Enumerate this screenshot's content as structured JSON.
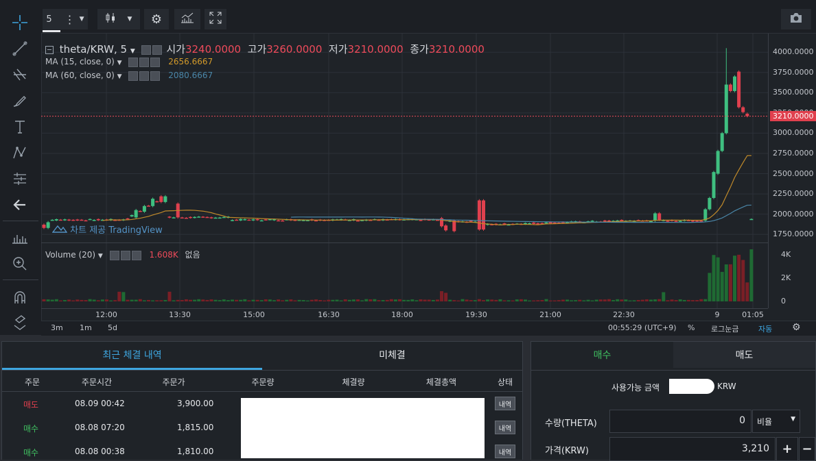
{
  "toolbar": {
    "interval": "5",
    "more_icon": "vertical-dots-icon",
    "chart_style_icon": "candlestick-icon",
    "settings_icon": "gear-icon",
    "indicators_icon": "indicators-icon",
    "fullscreen_icon": "fullscreen-icon",
    "screenshot_icon": "camera-icon"
  },
  "left_tools": [
    "crosshair-icon",
    "trendline-icon",
    "fib-icon",
    "brush-icon",
    "text-icon",
    "pattern-icon",
    "measure-icon",
    "back-arrow-icon",
    "ruler-icon",
    "zoom-icon",
    "magnet-icon",
    "lock-icon"
  ],
  "legend": {
    "symbol": "theta/KRW, 5",
    "open_label": "시가",
    "open_value": "3240.0000",
    "high_label": "고가",
    "high_value": "3260.0000",
    "low_label": "저가",
    "low_value": "3210.0000",
    "close_label": "종가",
    "close_value": "3210.0000",
    "ma15_label": "MA (15, close, 0)",
    "ma15_value": "2656.6667",
    "ma60_label": "MA (60, close, 0)",
    "ma60_value": "2080.6667",
    "volume_label": "Volume (20)",
    "volume_value": "1.608K",
    "volume_extra": "없음",
    "watermark": "차트 제공 TradingView"
  },
  "chart_data": {
    "type": "candlestick",
    "price_axis_ticks": [
      "4000.0000",
      "3750.0000",
      "3500.0000",
      "3250.0000",
      "3000.0000",
      "2750.0000",
      "2500.0000",
      "2250.0000",
      "2000.0000",
      "1750.0000"
    ],
    "price_ylim": [
      1650,
      4230
    ],
    "current_price": "3210.0000",
    "volume_axis_ticks": [
      "4K",
      "2K",
      "0"
    ],
    "time_ticks": [
      "12:00",
      "13:30",
      "15:00",
      "16:30",
      "18:00",
      "19:30",
      "21:00",
      "22:30",
      "9",
      "01:05"
    ]
  },
  "bottom_bar": {
    "ranges": [
      "3m",
      "1m",
      "5d"
    ],
    "clock": "00:55:29 (UTC+9)",
    "percent": "%",
    "log": "로그눈금",
    "auto": "자동",
    "settings_icon": "gear-icon"
  },
  "orders": {
    "tab_recent": "최근 체결 내역",
    "tab_open": "미체결",
    "headers": [
      "주문",
      "주문시간",
      "주문가",
      "주문량",
      "체결량",
      "체결총액",
      "상태"
    ],
    "rows": [
      {
        "side": "매도",
        "time": "08.09 00:42",
        "price": "3,900.00",
        "btn": "내역"
      },
      {
        "side": "매수",
        "time": "08.08 07:20",
        "price": "1,815.00",
        "btn": "내역"
      },
      {
        "side": "매수",
        "time": "08.08 00:38",
        "price": "1,810.00",
        "btn": "내역"
      }
    ],
    "colors": {
      "sell": "#e0404e",
      "buy": "#3fbf60"
    }
  },
  "trade": {
    "tab_buy": "매수",
    "tab_sell": "매도",
    "available_label": "사용가능 금액",
    "available_unit": "KRW",
    "qty_label": "수량(THETA)",
    "qty_value": "0",
    "ratio_label": "비율",
    "price_label": "가격(KRW)",
    "price_value": "3,210",
    "plus": "+",
    "minus": "−"
  }
}
